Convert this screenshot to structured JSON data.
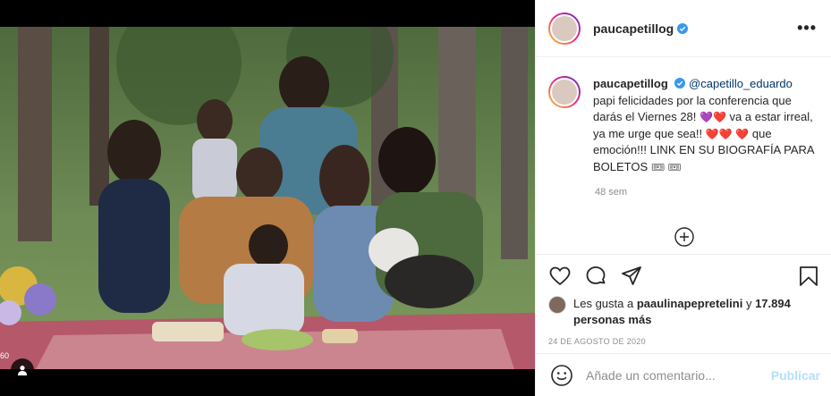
{
  "post": {
    "username": "paucapetillog",
    "more_label": "•••",
    "image_edge_text": "60"
  },
  "caption": {
    "username": "paucapetillog",
    "mention": "@capetillo_eduardo",
    "text_1": "papi felicidades por la conferencia que darás el Viernes 28!",
    "text_2": "va a estar irreal, ya me urge que sea!!",
    "text_3": "que emoción!!! LINK EN SU BIOGRAFÍA PARA BOLETOS",
    "emoji_1": "💜❤️",
    "emoji_2": "❤️❤️",
    "emoji_3": "❤️",
    "emoji_4": "🎟 🎟",
    "time": "48 sem"
  },
  "likes": {
    "prefix": "Les gusta a",
    "user": "paaulinapepretelini",
    "joiner": "y",
    "count": "17.894 personas más"
  },
  "date": "24 DE AGOSTO DE 2020",
  "comment_box": {
    "placeholder": "Añade un comentario...",
    "publish_label": "Publicar"
  },
  "colors": {
    "verified": "#3897f0",
    "publish_disabled": "#b2dffc",
    "mention": "#00376b"
  }
}
